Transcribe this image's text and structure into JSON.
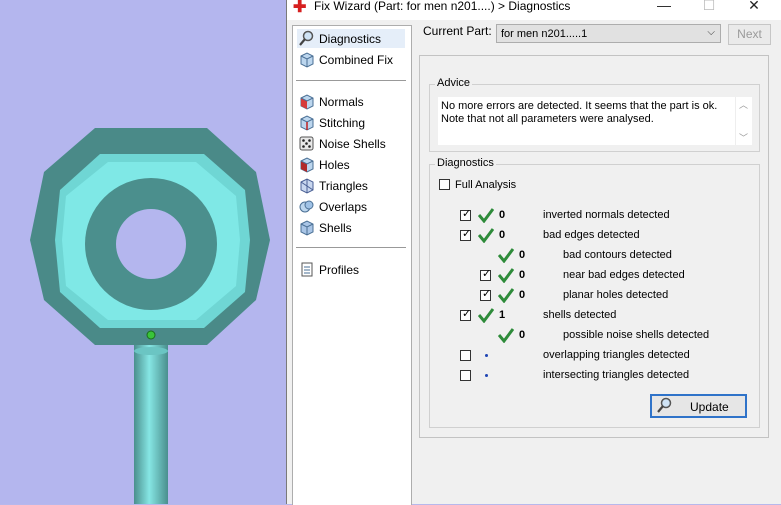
{
  "window": {
    "title": "Fix Wizard (Part: for men n201....) > Diagnostics",
    "app_icon": "red-cross-icon",
    "minimize_icon": "minimize-icon",
    "maximize_icon": "maximize-icon",
    "close_icon": "close-icon",
    "min_glyph": "—",
    "max_glyph": "☐",
    "close_glyph": "✕"
  },
  "sidebar": {
    "items": [
      {
        "label": "Diagnostics",
        "icon": "magnifier-icon",
        "active": true
      },
      {
        "label": "Combined Fix",
        "icon": "cube-icon"
      },
      {
        "label": "Normals",
        "icon": "cube-red-face-icon"
      },
      {
        "label": "Stitching",
        "icon": "cube-stitch-icon"
      },
      {
        "label": "Noise Shells",
        "icon": "dice-icon"
      },
      {
        "label": "Holes",
        "icon": "cube-hole-icon"
      },
      {
        "label": "Triangles",
        "icon": "triangle-cube-icon"
      },
      {
        "label": "Overlaps",
        "icon": "overlap-icon"
      },
      {
        "label": "Shells",
        "icon": "shells-icon"
      },
      {
        "label": "Profiles",
        "icon": "document-icon"
      }
    ]
  },
  "current_part": {
    "label": "Current Part:",
    "value": "for men n201.....1",
    "arrow": "⌵"
  },
  "next_button": {
    "label": "Next"
  },
  "advice": {
    "legend": "Advice",
    "text": "No more errors are detected. It seems that the part is ok. Note that not all parameters were analysed.",
    "scroll_up": "︿",
    "scroll_down": "﹀"
  },
  "diagnostics": {
    "legend": "Diagnostics",
    "full_analysis_label": "Full Analysis",
    "full_analysis_checked": false,
    "rows": [
      {
        "checkbox": true,
        "checked": true,
        "status": "ok",
        "count": "0",
        "label": "inverted normals detected",
        "indent": 0
      },
      {
        "checkbox": true,
        "checked": true,
        "status": "ok",
        "count": "0",
        "label": "bad edges detected",
        "indent": 0
      },
      {
        "checkbox": false,
        "checked": false,
        "status": "ok",
        "count": "0",
        "label": "bad contours detected",
        "indent": 1
      },
      {
        "checkbox": true,
        "checked": true,
        "status": "ok",
        "count": "0",
        "label": "near bad edges detected",
        "indent": 1
      },
      {
        "checkbox": true,
        "checked": true,
        "status": "ok",
        "count": "0",
        "label": "planar holes detected",
        "indent": 1
      },
      {
        "checkbox": true,
        "checked": true,
        "status": "ok",
        "count": "1",
        "label": "shells detected",
        "indent": 0
      },
      {
        "checkbox": false,
        "checked": false,
        "status": "ok",
        "count": "0",
        "label": "possible noise shells detected",
        "indent": 1
      },
      {
        "checkbox": true,
        "checked": false,
        "status": "pending",
        "count": "",
        "label": "overlapping triangles detected",
        "indent": 0
      },
      {
        "checkbox": true,
        "checked": false,
        "status": "pending",
        "count": "",
        "label": "intersecting triangles detected",
        "indent": 0
      }
    ]
  },
  "update_button": {
    "label": "Update",
    "icon": "magnifier-icon"
  },
  "colors": {
    "viewport_bg": "#b4b6ee",
    "part_dark": "#4f8f8c",
    "part_light": "#7fe8e6",
    "check_green": "#2e8b3a",
    "selection_dot": "#39c439",
    "accent": "#2f73c9"
  }
}
